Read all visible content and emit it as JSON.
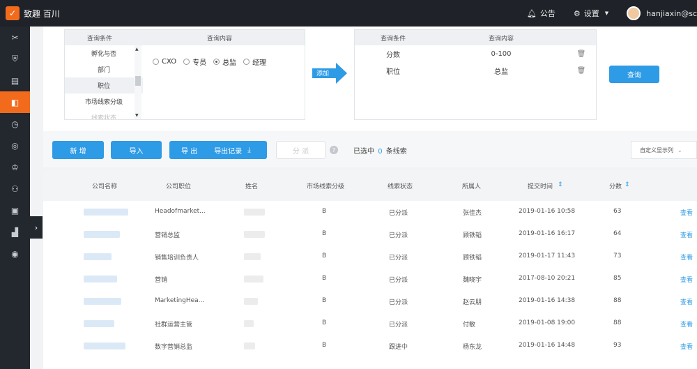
{
  "header": {
    "logo_text": "致趣 百川",
    "notice": "公告",
    "settings": "设置",
    "user": "hanjiaxin@sc"
  },
  "query": {
    "left_headers": [
      "查询条件",
      "查询内容"
    ],
    "conditions": [
      "孵化与否",
      "部门",
      "职位",
      "市场线索分级",
      "线索状态"
    ],
    "radios": [
      {
        "label": "CXO",
        "checked": false
      },
      {
        "label": "专员",
        "checked": false
      },
      {
        "label": "总监",
        "checked": true
      },
      {
        "label": "经理",
        "checked": false
      }
    ],
    "add_label": "添加",
    "right_headers": [
      "查询条件",
      "查询内容"
    ],
    "selected": [
      {
        "condition": "分数",
        "content": "0-100"
      },
      {
        "condition": "职位",
        "content": "总监"
      }
    ],
    "search_label": "查询"
  },
  "toolbar": {
    "new_label": "新 增",
    "import_label": "导入",
    "export_label": "导 出",
    "export_record_label": "导出记录",
    "assign_label": "分 派",
    "selected_prefix": "已选中",
    "selected_count": "0",
    "selected_suffix": "条线索",
    "custom_columns": "自定义显示列"
  },
  "table": {
    "columns": [
      "公司名称",
      "公司职位",
      "姓名",
      "市场线索分级",
      "线索状态",
      "所属人",
      "提交时间",
      "分数"
    ],
    "rows": [
      {
        "title": "Headofmarket...",
        "grade": "B",
        "status": "已分派",
        "owner": "张佳杰",
        "time": "2019-01-16 10:58",
        "score": "63",
        "action": "查看"
      },
      {
        "title": "营销总监",
        "grade": "B",
        "status": "已分派",
        "owner": "顾铁韬",
        "time": "2019-01-16 16:17",
        "score": "64",
        "action": "查看"
      },
      {
        "title": "销售培训负责人",
        "grade": "B",
        "status": "已分派",
        "owner": "顾铁韬",
        "time": "2019-01-17 11:43",
        "score": "73",
        "action": "查看"
      },
      {
        "title": "营销",
        "grade": "B",
        "status": "已分派",
        "owner": "魏晓宇",
        "time": "2017-08-10 20:21",
        "score": "85",
        "action": "查看"
      },
      {
        "title": "MarketingHea...",
        "grade": "B",
        "status": "已分派",
        "owner": "赵云朋",
        "time": "2019-01-16 14:38",
        "score": "88",
        "action": "查看"
      },
      {
        "title": "社群运营主管",
        "grade": "B",
        "status": "已分派",
        "owner": "付敏",
        "time": "2019-01-08 19:00",
        "score": "88",
        "action": "查看"
      },
      {
        "title": "数字营销总监",
        "grade": "B",
        "status": "跟进中",
        "owner": "杨东龙",
        "time": "2019-01-16 14:48",
        "score": "93",
        "action": "查看"
      }
    ]
  },
  "colors": {
    "accent": "#2e9be6",
    "brand": "#f26b1d",
    "sidebar": "#23272e"
  }
}
